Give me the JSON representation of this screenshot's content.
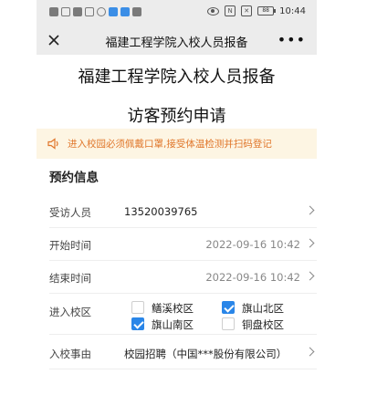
{
  "status_bar": {
    "time": "10:44",
    "battery": "88"
  },
  "nav": {
    "title": "福建工程学院入校人员报备",
    "more": "•••"
  },
  "header": {
    "title": "福建工程学院入校人员报备",
    "subtitle": "访客预约申请"
  },
  "notice": {
    "text": "进入校园必须佩戴口罩,接受体温检测并扫码登记"
  },
  "section": {
    "title": "预约信息"
  },
  "form": {
    "host_label": "受访人员",
    "host_value": "13520039765",
    "start_label": "开始时间",
    "start_value": "2022-09-16 10:42",
    "end_label": "结束时间",
    "end_value": "2022-09-16 10:42",
    "campus_label": "进入校区",
    "campus_options": [
      {
        "label": "鳝溪校区",
        "checked": false
      },
      {
        "label": "旗山北区",
        "checked": true
      },
      {
        "label": "旗山南区",
        "checked": true
      },
      {
        "label": "铜盘校区",
        "checked": false
      }
    ],
    "reason_label": "入校事由",
    "reason_value": "校园招聘（中国***股份有限公司）"
  },
  "colors": {
    "accent": "#2a86e8",
    "notice_text": "#e0762a",
    "notice_bg": "#fdf5e3"
  }
}
